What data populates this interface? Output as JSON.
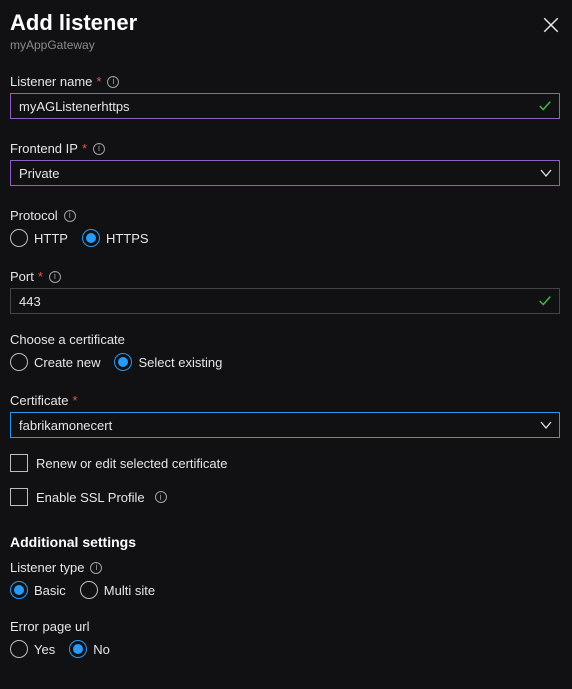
{
  "header": {
    "title": "Add listener",
    "subtitle": "myAppGateway"
  },
  "listener_name": {
    "label": "Listener name",
    "value": "myAGListenerhttps"
  },
  "frontend_ip": {
    "label": "Frontend IP",
    "value": "Private"
  },
  "protocol": {
    "label": "Protocol",
    "http": "HTTP",
    "https": "HTTPS"
  },
  "port": {
    "label": "Port",
    "value": "443"
  },
  "choose_cert": {
    "label": "Choose a certificate",
    "create": "Create new",
    "select": "Select existing"
  },
  "certificate": {
    "label": "Certificate",
    "value": "fabrikamonecert"
  },
  "renew_label": "Renew or edit selected certificate",
  "ssl_profile_label": "Enable SSL Profile",
  "additional_heading": "Additional settings",
  "listener_type": {
    "label": "Listener type",
    "basic": "Basic",
    "multi": "Multi site"
  },
  "error_page": {
    "label": "Error page url",
    "yes": "Yes",
    "no": "No"
  }
}
